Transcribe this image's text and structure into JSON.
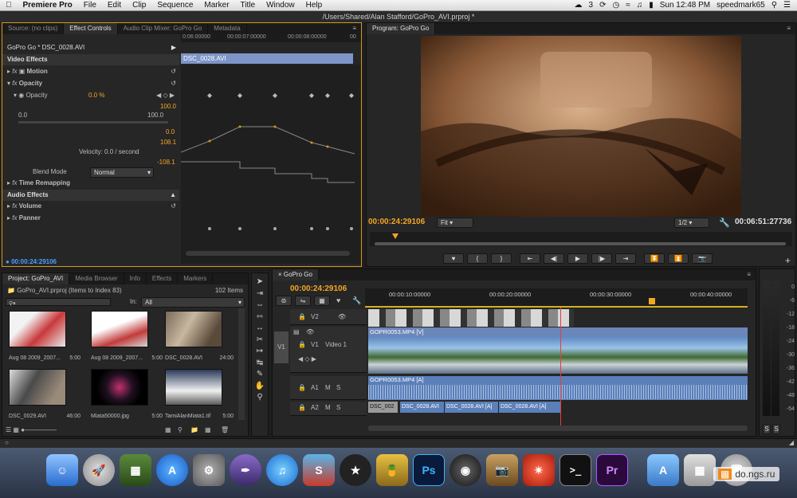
{
  "menubar": {
    "app": "Premiere Pro",
    "items": [
      "File",
      "Edit",
      "Clip",
      "Sequence",
      "Marker",
      "Title",
      "Window",
      "Help"
    ],
    "notif_count": "3",
    "clock": "Sun 12:48 PM",
    "user": "speedmark65"
  },
  "window_title": "/Users/Shared/Alan Stafford/GoPro_AVI.prproj *",
  "effect_panel": {
    "tabs": [
      "Source: (no clips)",
      "Effect Controls",
      "Audio Clip Mixer: GoPro Go",
      "Metadata"
    ],
    "clip_title": "GoPro Go * DSC_0028.AVI",
    "ruler": [
      "0:06:00000",
      "00:00:07:00000",
      "00:00:08:00000",
      "00"
    ],
    "clip_bar": "DSC_0028.AVI",
    "video_effects": "Video Effects",
    "motion": "Motion",
    "opacity": "Opacity",
    "opacity_param": "Opacity",
    "opacity_value": "0.0 %",
    "val_100_a": "100.0",
    "val_00_a": "0.0",
    "val_100_b": "100.0",
    "val_00_b": "0.0",
    "val_1081": "108.1",
    "velocity": "Velocity: 0.0 / second",
    "val_neg1081": "-108.1",
    "blend_mode_label": "Blend Mode",
    "blend_mode_value": "Normal",
    "time_remapping": "Time Remapping",
    "audio_effects": "Audio Effects",
    "volume": "Volume",
    "panner": "Panner",
    "timecode": "00:00:24:29106"
  },
  "program": {
    "tab": "Program: GoPro Go",
    "timecode": "00:00:24:29106",
    "fit": "Fit",
    "ratio": "1/2",
    "duration": "00:06:51:27736"
  },
  "project": {
    "tabs": [
      "Project: GoPro_AVI",
      "Media Browser",
      "Info",
      "Effects",
      "Markers"
    ],
    "file": "GoPro_AVI.prproj (Items to Index 83)",
    "count": "102 Items",
    "in_label": "In:",
    "in_value": "All",
    "items": [
      {
        "name": "Aug 08 2009_2007...",
        "dur": "5:00"
      },
      {
        "name": "Aug 08 2009_2007...",
        "dur": "5:00"
      },
      {
        "name": "DSC_0028.AVI",
        "dur": "24:00"
      },
      {
        "name": "DSC_0029.AVI",
        "dur": "46:00"
      },
      {
        "name": "Miata50000.jpg",
        "dur": "5:00"
      },
      {
        "name": "TamiAlanMiata1.tif",
        "dur": "5:00"
      }
    ]
  },
  "timeline": {
    "tab": "GoPro Go",
    "timecode": "00:00:24:29106",
    "ruler": [
      "00:00:10:00000",
      "00:00:20:00000",
      "00:00:30:00000",
      "00:00:40:00000"
    ],
    "tracks": [
      "V2",
      "V1",
      "Video 1",
      "A1",
      "A2"
    ],
    "source_patch": "V1",
    "v1_clip": "GOPR0053.MP4 [V]",
    "a1_clip": "GOPR0053.MP4 [A]",
    "a2_clips": [
      "DSC_002",
      "DSC_0028.AVI",
      "DSC_0028.AVI [A]",
      "DSC_0028.AVI [A]"
    ]
  },
  "meter": {
    "labels": [
      "0",
      "-6",
      "-12",
      "-18",
      "-24",
      "-30",
      "-36",
      "-42",
      "-48",
      "-54"
    ],
    "solo": [
      "S",
      "S"
    ]
  },
  "watermark": "do.ngs.ru",
  "dock_labels": {
    "ps": "Ps",
    "pr": "Pr"
  }
}
